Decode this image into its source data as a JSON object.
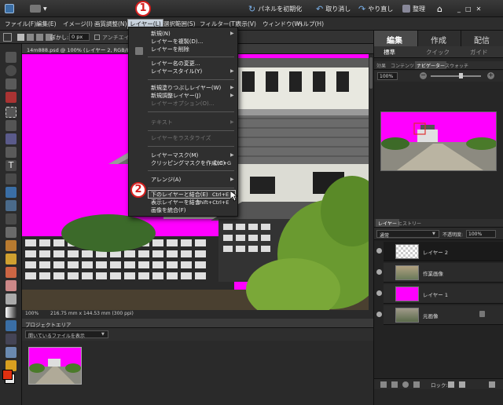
{
  "topbar": {
    "reset_panels": "パネルを初期化",
    "undo": "取り消し",
    "redo": "やり直し",
    "organize": "整理"
  },
  "menubar": {
    "items": [
      "ファイル(F)",
      "編集(E)",
      "イメージ(I)",
      "画質調整(N)",
      "レイヤー(L)",
      "選択範囲(S)",
      "フィルター(T)",
      "表示(V)",
      "ウィンドウ(W)",
      "ヘルプ(H)"
    ],
    "active_index": 4
  },
  "options_bar": {
    "feather_label": "ぼかし:",
    "feather_value": "0 px",
    "antialias_label": "アンチエイリアス"
  },
  "document": {
    "tab_title": "14m888.psd @ 100% (レイヤー 2, RGB/8) *",
    "zoom": "100%",
    "dimensions": "216.75 mm x 144.53 mm (300 ppi)"
  },
  "project_area": {
    "title": "プロジェクトエリア",
    "select_value": "開いているファイルを表示"
  },
  "dropdown": {
    "groups": [
      [
        {
          "label": "新規(N)",
          "shortcut": "",
          "submenu": true,
          "enabled": true
        },
        {
          "label": "レイヤーを複製(D)...",
          "shortcut": "",
          "submenu": false,
          "enabled": true
        },
        {
          "label": "レイヤーを削除",
          "shortcut": "",
          "submenu": false,
          "enabled": true
        }
      ],
      [
        {
          "label": "レイヤー名の変更...",
          "shortcut": "",
          "submenu": false,
          "enabled": true
        },
        {
          "label": "レイヤースタイル(Y)",
          "shortcut": "",
          "submenu": true,
          "enabled": true
        }
      ],
      [
        {
          "label": "新規塗りつぶしレイヤー(W)",
          "shortcut": "",
          "submenu": true,
          "enabled": true
        },
        {
          "label": "新規調整レイヤー(J)",
          "shortcut": "",
          "submenu": true,
          "enabled": true
        },
        {
          "label": "レイヤーオプション(O)...",
          "shortcut": "",
          "submenu": false,
          "enabled": false
        }
      ],
      [
        {
          "label": "テキスト",
          "shortcut": "",
          "submenu": true,
          "enabled": false
        }
      ],
      [
        {
          "label": "レイヤーをラスタライズ",
          "shortcut": "",
          "submenu": false,
          "enabled": false
        }
      ],
      [
        {
          "label": "レイヤーマスク(M)",
          "shortcut": "",
          "submenu": true,
          "enabled": true
        },
        {
          "label": "クリッピングマスクを作成(C)",
          "shortcut": "Ctrl+G",
          "submenu": false,
          "enabled": true
        }
      ],
      [
        {
          "label": "アレンジ(A)",
          "shortcut": "",
          "submenu": true,
          "enabled": true
        }
      ],
      [
        {
          "label": "下のレイヤーと結合(E)",
          "shortcut": "Ctrl+E",
          "submenu": false,
          "enabled": true
        },
        {
          "label": "表示レイヤーを結合",
          "shortcut": "Shift+Ctrl+E",
          "submenu": false,
          "enabled": true
        },
        {
          "label": "画像を統合(F)",
          "shortcut": "",
          "submenu": false,
          "enabled": true
        }
      ]
    ]
  },
  "annotations": {
    "step1": "1",
    "step2": "2"
  },
  "right_panel": {
    "main_tabs": [
      "編集",
      "作成",
      "配信"
    ],
    "sub_tabs": [
      "標準",
      "クイック",
      "ガイド"
    ],
    "palette_tabs": [
      "効果",
      "コンテンツ",
      "ナビゲーター",
      "スウォッチ"
    ],
    "nav_zoom": "100%",
    "layers_tabs": [
      "レイヤー",
      "ヒストリー"
    ],
    "blend_mode": "通常",
    "opacity_label": "不透明度:",
    "opacity_value": "100%",
    "lock_label": "ロック:",
    "layers": [
      {
        "name": "レイヤー 2",
        "thumb": "transparent",
        "selected": true
      },
      {
        "name": "作業画像",
        "thumb": "photo",
        "selected": false
      },
      {
        "name": "レイヤー 1",
        "thumb": "magenta",
        "selected": false
      },
      {
        "name": "元画像",
        "thumb": "photo",
        "selected": false
      }
    ]
  },
  "colors": {
    "magenta": "#ff00ff",
    "accent_blue": "#3a6ea5",
    "annotation_red": "#d62020"
  }
}
